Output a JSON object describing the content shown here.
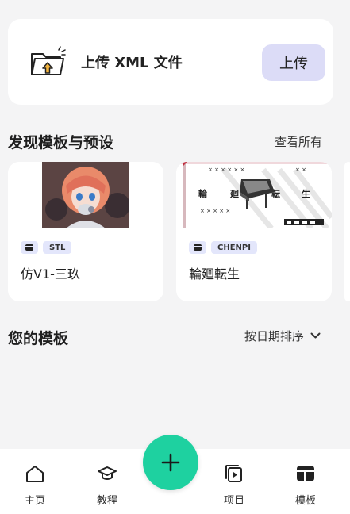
{
  "upload": {
    "text": "上传 XML 文件",
    "button": "上传",
    "icon": "folder-upload-icon"
  },
  "discover": {
    "title": "发现模板与预设",
    "view_all": "查看所有",
    "cards": [
      {
        "tag": "STL",
        "name": "仿V1-三玖"
      },
      {
        "tag": "CHENPI",
        "name": "輪廻転生",
        "thumb_text": [
          "輪",
          "廻",
          "転",
          "生"
        ]
      }
    ]
  },
  "my_templates": {
    "title": "您的模板",
    "sort_label": "按日期排序",
    "sort_icon": "chevron-down-icon"
  },
  "nav": {
    "items": [
      {
        "label": "主页",
        "icon": "home-icon"
      },
      {
        "label": "教程",
        "icon": "graduation-cap-icon"
      },
      {
        "label": "项目",
        "icon": "project-icon"
      },
      {
        "label": "模板",
        "icon": "template-icon"
      }
    ],
    "fab_icon": "plus-icon"
  },
  "colors": {
    "accent": "#1ed1a0",
    "upload_button": "#dcdcf7",
    "tag_background": "#e3e6fb",
    "background": "#f4f4f5"
  }
}
